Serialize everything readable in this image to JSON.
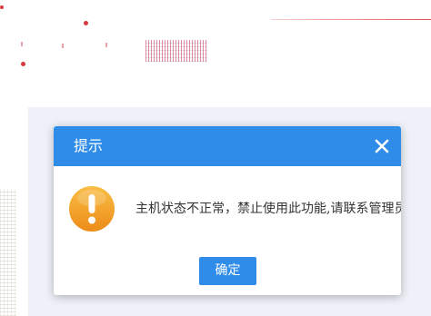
{
  "dialog": {
    "title": "提示",
    "message": "主机状态不正常，禁止使用此功能,请联系管理员",
    "confirm_label": "确定",
    "icons": {
      "close": "close-icon",
      "warning": "exclamation-warning-icon"
    },
    "colors": {
      "header": "#2f8ce8",
      "button": "#2f8ce8",
      "warning_gradient_top": "#f7b33a",
      "warning_gradient_bottom": "#ee8f1b"
    }
  }
}
